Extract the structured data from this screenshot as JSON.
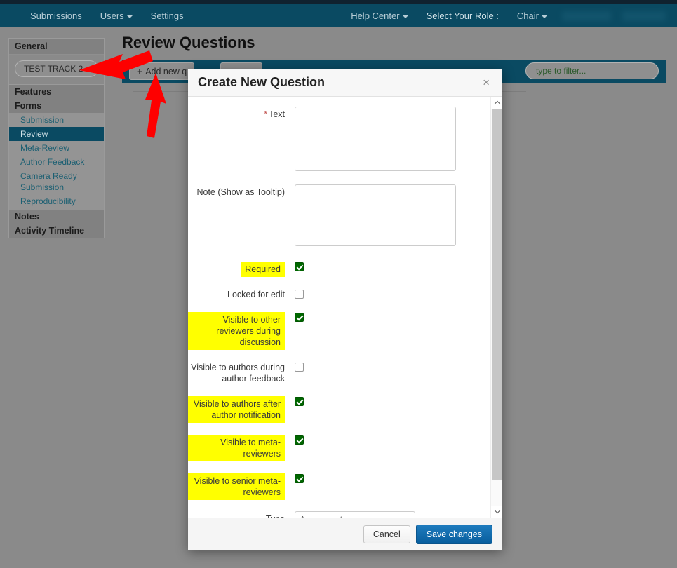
{
  "navbar": {
    "left_items": [
      {
        "label": "Submissions",
        "caret": false
      },
      {
        "label": "Users",
        "caret": true
      },
      {
        "label": "Settings",
        "caret": false
      }
    ],
    "right_items": [
      {
        "label": "Help Center",
        "caret": true
      },
      {
        "label": "Select Your Role :",
        "caret": false
      },
      {
        "label": "Chair",
        "caret": true
      }
    ],
    "background": "#0a4a62"
  },
  "sidebar": {
    "general_label": "General",
    "track_name": "TEST TRACK 2",
    "features_label": "Features",
    "forms_label": "Forms",
    "forms_items": [
      {
        "label": "Submission",
        "active": false
      },
      {
        "label": "Review",
        "active": true
      },
      {
        "label": "Meta-Review",
        "active": false
      },
      {
        "label": "Author Feedback",
        "active": false
      },
      {
        "label": "Camera Ready Submission",
        "active": false
      },
      {
        "label": "Reproducibility",
        "active": false
      }
    ],
    "notes_label": "Notes",
    "activity_label": "Activity Timeline",
    "active_color": "#0a4a62"
  },
  "page": {
    "title": "Review Questions"
  },
  "toolbar": {
    "add_label": "Add new q",
    "add_icon": "plus-icon",
    "filter_placeholder": "type to filter...",
    "background": "#0a4a62"
  },
  "modal": {
    "title": "Create New Question",
    "close_icon": "close-icon",
    "fields": {
      "text": {
        "label": "Text",
        "required_marker": "*",
        "value": "",
        "placeholder": ""
      },
      "note": {
        "label": "Note (Show as Tooltip)",
        "value": "",
        "placeholder": ""
      }
    },
    "checkboxes": [
      {
        "label": "Required",
        "checked": true,
        "highlighted": true
      },
      {
        "label": "Locked for edit",
        "checked": false,
        "highlighted": false
      },
      {
        "label": "Visible to other reviewers during discussion",
        "checked": true,
        "highlighted": true
      },
      {
        "label": "Visible to authors during author feedback",
        "checked": false,
        "highlighted": false
      },
      {
        "label": "Visible to authors after author notification",
        "checked": true,
        "highlighted": true
      },
      {
        "label": "Visible to meta-reviewers",
        "checked": true,
        "highlighted": true
      },
      {
        "label": "Visible to senior meta-reviewers",
        "checked": true,
        "highlighted": true
      }
    ],
    "type_field": {
      "label": "Type",
      "selected": "Agreement",
      "options": [
        "Agreement"
      ]
    },
    "footer": {
      "cancel_label": "Cancel",
      "save_label": "Save changes"
    },
    "highlight_color": "#ffff00",
    "checked_color": "#006600",
    "save_color": "#0a63a5"
  },
  "annotations": {
    "arrow_color": "#fe0000",
    "arrow_count": 2
  }
}
